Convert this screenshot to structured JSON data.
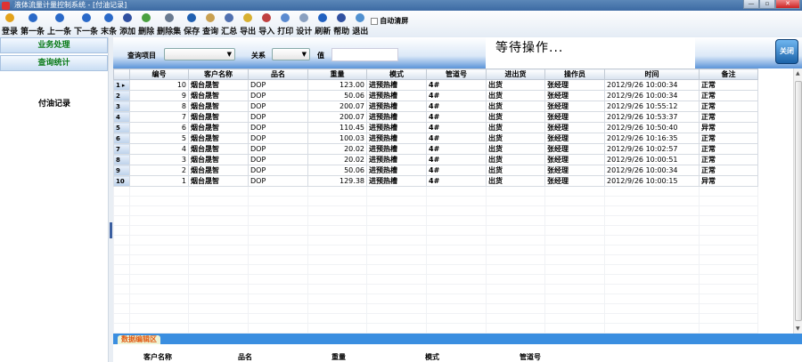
{
  "window": {
    "title": "液体流量计量控制系统 - [付油记录]",
    "controls": [
      "—",
      "▫",
      "✕"
    ]
  },
  "toolbar": {
    "buttons": [
      {
        "label": "登录",
        "icon": "key-icon",
        "color": "#e3a21a"
      },
      {
        "label": "第一条",
        "icon": "first-record-icon",
        "color": "#2a69c8"
      },
      {
        "label": "上一条",
        "icon": "previous-record-icon",
        "color": "#2a69c8"
      },
      {
        "label": "下一条",
        "icon": "next-record-icon",
        "color": "#2a69c8"
      },
      {
        "label": "末条",
        "icon": "last-record-icon",
        "color": "#2a69c8"
      },
      {
        "label": "添加",
        "icon": "add-pen-icon",
        "color": "#3050a0"
      },
      {
        "label": "删除",
        "icon": "delete-icon",
        "color": "#4aa040"
      },
      {
        "label": "删除集",
        "icon": "delete-set-icon",
        "color": "#6a7a90"
      },
      {
        "label": "保存",
        "icon": "save-icon",
        "color": "#1f5fb0"
      },
      {
        "label": "查询",
        "icon": "search-icon",
        "color": "#c9a050"
      },
      {
        "label": "汇总",
        "icon": "summary-icon",
        "color": "#5070b0"
      },
      {
        "label": "导出",
        "icon": "export-icon",
        "color": "#d8b030"
      },
      {
        "label": "导入",
        "icon": "import-icon",
        "color": "#c04040"
      },
      {
        "label": "打印",
        "icon": "print-icon",
        "color": "#5a8ad0"
      },
      {
        "label": "设计",
        "icon": "design-icon",
        "color": "#8aa0c0"
      },
      {
        "label": "刷新",
        "icon": "refresh-icon",
        "color": "#2060c0"
      },
      {
        "label": "帮助",
        "icon": "help-book-icon",
        "color": "#3050a0"
      },
      {
        "label": "退出",
        "icon": "exit-icon",
        "color": "#5090d0"
      }
    ],
    "auto_clear_label": "自动清屏"
  },
  "sidebar": {
    "buttons": [
      "业务处理",
      "查询统计"
    ],
    "items": [
      "付油记录"
    ]
  },
  "query": {
    "item_label": "查询项目",
    "item_value": "",
    "relation_label": "关系",
    "relation_value": "",
    "value_label": "值",
    "value": "",
    "status": "等待操作...",
    "close_label": "关闭"
  },
  "grid": {
    "columns": [
      "编号",
      "客户名称",
      "品名",
      "重量",
      "模式",
      "管道号",
      "进出货",
      "操作员",
      "时间",
      "备注"
    ],
    "rows": [
      [
        "10",
        "烟台晟智",
        "DOP",
        "123.00",
        "进预热槽",
        "4#",
        "出货",
        "张经理",
        "2012/9/26 10:00:34",
        "正常"
      ],
      [
        "9",
        "烟台晟智",
        "DOP",
        "50.06",
        "进预热槽",
        "4#",
        "出货",
        "张经理",
        "2012/9/26 10:00:34",
        "正常"
      ],
      [
        "8",
        "烟台晟智",
        "DOP",
        "200.07",
        "进预热槽",
        "4#",
        "出货",
        "张经理",
        "2012/9/26 10:55:12",
        "正常"
      ],
      [
        "7",
        "烟台晟智",
        "DOP",
        "200.07",
        "进预热槽",
        "4#",
        "出货",
        "张经理",
        "2012/9/26 10:53:37",
        "正常"
      ],
      [
        "6",
        "烟台晟智",
        "DOP",
        "110.45",
        "进预热槽",
        "4#",
        "出货",
        "张经理",
        "2012/9/26 10:50:40",
        "异常"
      ],
      [
        "5",
        "烟台晟智",
        "DOP",
        "100.03",
        "进预热槽",
        "4#",
        "出货",
        "张经理",
        "2012/9/26 10:16:35",
        "正常"
      ],
      [
        "4",
        "烟台晟智",
        "DOP",
        "20.02",
        "进预热槽",
        "4#",
        "出货",
        "张经理",
        "2012/9/26 10:02:57",
        "正常"
      ],
      [
        "3",
        "烟台晟智",
        "DOP",
        "20.02",
        "进预热槽",
        "4#",
        "出货",
        "张经理",
        "2012/9/26 10:00:51",
        "正常"
      ],
      [
        "2",
        "烟台晟智",
        "DOP",
        "50.06",
        "进预热槽",
        "4#",
        "出货",
        "张经理",
        "2012/9/26 10:00:34",
        "正常"
      ],
      [
        "1",
        "烟台晟智",
        "DOP",
        "129.38",
        "进预热槽",
        "4#",
        "出货",
        "张经理",
        "2012/9/26 10:00:15",
        "异常"
      ]
    ],
    "row_numbers": [
      "1",
      "2",
      "3",
      "4",
      "5",
      "6",
      "7",
      "8",
      "9",
      "10"
    ],
    "current_row_marker": "▸"
  },
  "edit": {
    "tab_label": "数据编辑区",
    "fields": [
      "客户名称",
      "品名",
      "重量",
      "模式",
      "管道号"
    ]
  }
}
